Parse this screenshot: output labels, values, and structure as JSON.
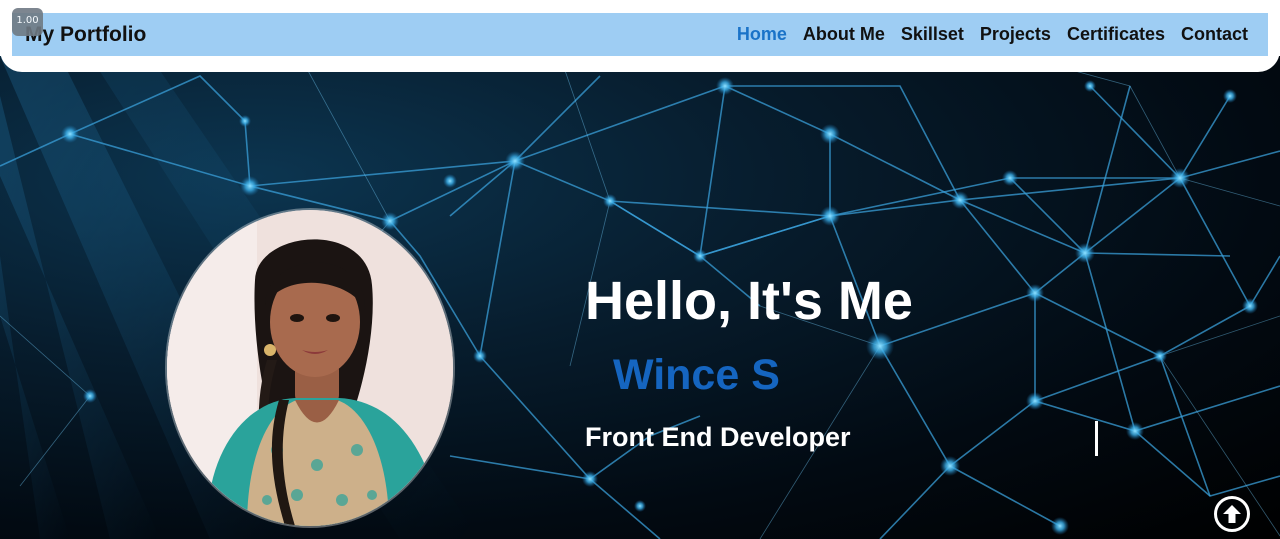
{
  "zoom_badge": "1.00",
  "header": {
    "brand": "My Portfolio",
    "nav": [
      {
        "label": "Home",
        "active": true
      },
      {
        "label": "About Me",
        "active": false
      },
      {
        "label": "Skillset",
        "active": false
      },
      {
        "label": "Projects",
        "active": false
      },
      {
        "label": "Certificates",
        "active": false
      },
      {
        "label": "Contact",
        "active": false
      }
    ]
  },
  "hero": {
    "greeting": "Hello, It's Me",
    "name": "Wince S",
    "role": "Front End Developer",
    "scroll_top_icon": "arrow-up-circle-icon",
    "background": "network-nodes"
  },
  "colors": {
    "navbar_bg": "#9ecdf3",
    "nav_active": "#1a73c8",
    "name_color": "#1565c0",
    "hero_bg": "#020a12",
    "network_line": "#3a9fd8"
  }
}
